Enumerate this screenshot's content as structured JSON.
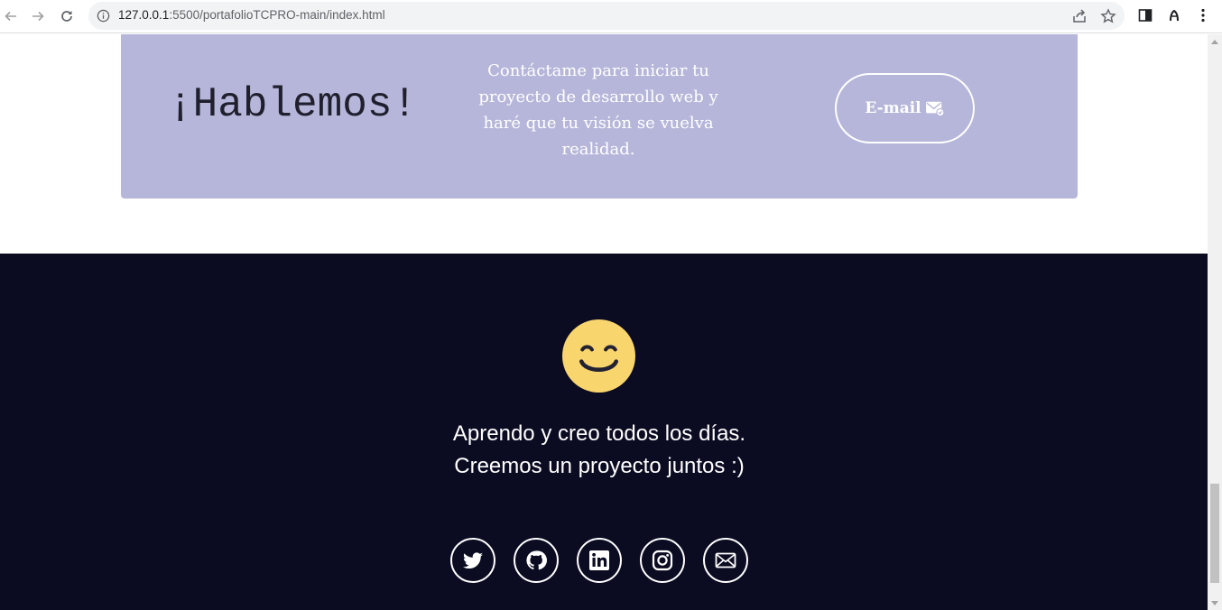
{
  "browser": {
    "url_host": "127.0.0.1",
    "url_rest": ":5500/portafolioTCPRO-main/index.html"
  },
  "contact": {
    "title": "¡Hablemos!",
    "message": "Contáctame para iniciar tu proyecto de desarrollo web y haré que tu visión se vuelva realidad.",
    "email_label": "E-mail"
  },
  "footer": {
    "line1": "Aprendo y creo todos los días.",
    "line2": "Creemos un proyecto juntos :)",
    "socials": [
      "twitter-icon",
      "github-icon",
      "linkedin-icon",
      "instagram-icon",
      "mail-icon"
    ]
  },
  "colors": {
    "contact_bg": "#b6b6da",
    "footer_bg": "#0b0b22",
    "smile_yellow": "#f9d56e"
  }
}
